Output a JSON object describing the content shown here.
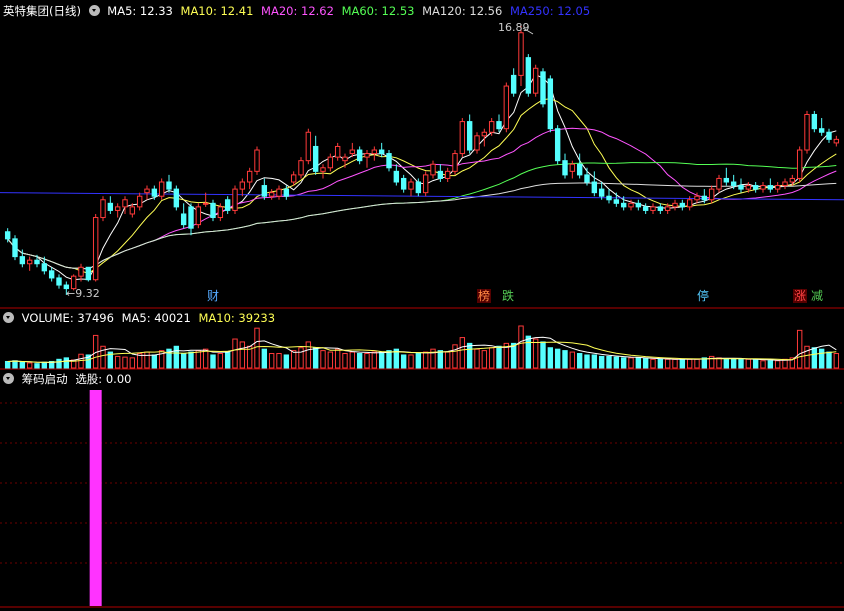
{
  "main_panel": {
    "stock_title": "英特集团(日线)",
    "ma_labels": [
      {
        "text": "MA5: 12.33",
        "color": "#ffffff"
      },
      {
        "text": "MA10: 12.41",
        "color": "#ffff55"
      },
      {
        "text": "MA20: 12.62",
        "color": "#ff55ff"
      },
      {
        "text": "MA60: 12.53",
        "color": "#55ff55"
      },
      {
        "text": "MA120: 12.56",
        "color": "#dddddd"
      },
      {
        "text": "MA250: 12.05",
        "color": "#3333ff"
      }
    ],
    "high_label": "16.89",
    "low_label": "←9.32",
    "event_markers": [
      {
        "text": "财",
        "color": "#55aaff"
      },
      {
        "text": "榜",
        "color": "#ff8844"
      },
      {
        "text": "跌",
        "color": "#55cc55"
      },
      {
        "text": "停",
        "color": "#55ccff"
      },
      {
        "text": "涨",
        "color": "#ff4444"
      },
      {
        "text": "减",
        "color": "#55cc55"
      }
    ]
  },
  "volume_panel": {
    "title": "VOLUME: 37496",
    "ma5": "MA5: 40021",
    "ma10": "MA10: 39233"
  },
  "indicator_panel": {
    "title": "筹码启动",
    "selection": "选股: 0.00"
  },
  "colors": {
    "up": "#ff3a3a",
    "down": "#55ffff",
    "grid": "#6b0000",
    "signal": "#ff33ff"
  },
  "chart_data": {
    "type": "candlestick",
    "y_range": [
      9.32,
      16.89
    ],
    "candles": [
      [
        11.1,
        11.2,
        10.8,
        10.9
      ],
      [
        10.9,
        11.0,
        10.3,
        10.4
      ],
      [
        10.4,
        10.6,
        10.1,
        10.2
      ],
      [
        10.2,
        10.4,
        10.0,
        10.3
      ],
      [
        10.3,
        10.45,
        10.1,
        10.2
      ],
      [
        10.2,
        10.4,
        9.9,
        10.0
      ],
      [
        10.0,
        10.1,
        9.7,
        9.8
      ],
      [
        9.8,
        9.9,
        9.5,
        9.6
      ],
      [
        9.6,
        9.7,
        9.32,
        9.5
      ],
      [
        9.5,
        9.9,
        9.45,
        9.85
      ],
      [
        9.85,
        10.2,
        9.7,
        10.1
      ],
      [
        10.1,
        10.0,
        9.7,
        9.75
      ],
      [
        9.75,
        11.6,
        9.7,
        11.5
      ],
      [
        11.5,
        12.1,
        11.4,
        12.0
      ],
      [
        11.9,
        12.1,
        11.6,
        11.7
      ],
      [
        11.7,
        11.9,
        11.5,
        11.8
      ],
      [
        11.8,
        12.1,
        11.6,
        12.0
      ],
      [
        11.6,
        11.9,
        11.5,
        11.8
      ],
      [
        11.8,
        12.2,
        11.7,
        12.1
      ],
      [
        12.2,
        12.4,
        12.0,
        12.3
      ],
      [
        12.3,
        12.4,
        12.0,
        12.1
      ],
      [
        12.1,
        12.6,
        12.0,
        12.5
      ],
      [
        12.5,
        12.7,
        12.2,
        12.3
      ],
      [
        12.3,
        12.4,
        11.7,
        11.8
      ],
      [
        11.6,
        11.9,
        11.2,
        11.3
      ],
      [
        11.8,
        11.9,
        11.0,
        11.2
      ],
      [
        11.3,
        11.9,
        11.2,
        11.8
      ],
      [
        11.9,
        12.2,
        11.8,
        11.9
      ],
      [
        11.9,
        12.0,
        11.4,
        11.5
      ],
      [
        11.5,
        11.9,
        11.4,
        11.8
      ],
      [
        12.0,
        12.1,
        11.6,
        11.7
      ],
      [
        11.7,
        12.4,
        11.6,
        12.3
      ],
      [
        12.3,
        12.6,
        12.1,
        12.5
      ],
      [
        12.5,
        12.9,
        12.3,
        12.8
      ],
      [
        12.8,
        13.5,
        12.7,
        13.4
      ],
      [
        12.4,
        12.6,
        12.0,
        12.1
      ],
      [
        12.1,
        12.3,
        12.0,
        12.2
      ],
      [
        12.1,
        12.4,
        12.0,
        12.3
      ],
      [
        12.3,
        12.4,
        12.0,
        12.1
      ],
      [
        12.5,
        12.8,
        12.4,
        12.7
      ],
      [
        12.7,
        13.2,
        12.6,
        13.1
      ],
      [
        13.1,
        14.0,
        13.0,
        13.9
      ],
      [
        13.5,
        13.8,
        12.7,
        12.8
      ],
      [
        12.8,
        13.0,
        12.6,
        12.9
      ],
      [
        12.9,
        13.3,
        12.8,
        13.2
      ],
      [
        13.2,
        13.6,
        13.1,
        13.5
      ],
      [
        13.1,
        13.3,
        12.9,
        13.2
      ],
      [
        13.3,
        13.6,
        13.2,
        13.4
      ],
      [
        13.4,
        13.5,
        13.0,
        13.1
      ],
      [
        13.2,
        13.4,
        12.9,
        13.3
      ],
      [
        13.3,
        13.5,
        13.1,
        13.4
      ],
      [
        13.4,
        13.6,
        13.2,
        13.3
      ],
      [
        13.3,
        13.4,
        12.8,
        12.9
      ],
      [
        12.8,
        13.0,
        12.4,
        12.5
      ],
      [
        12.6,
        12.7,
        12.2,
        12.3
      ],
      [
        12.3,
        12.6,
        12.1,
        12.5
      ],
      [
        12.5,
        12.6,
        12.1,
        12.2
      ],
      [
        12.2,
        12.8,
        12.1,
        12.7
      ],
      [
        12.7,
        13.1,
        12.6,
        13.0
      ],
      [
        12.8,
        13.0,
        12.5,
        12.6
      ],
      [
        12.6,
        12.9,
        12.5,
        12.8
      ],
      [
        12.8,
        13.4,
        12.7,
        13.3
      ],
      [
        13.3,
        14.3,
        13.2,
        14.2
      ],
      [
        14.2,
        14.4,
        13.3,
        13.4
      ],
      [
        13.4,
        13.9,
        13.3,
        13.8
      ],
      [
        13.8,
        14.0,
        13.5,
        13.9
      ],
      [
        13.9,
        14.3,
        13.8,
        14.2
      ],
      [
        14.2,
        14.4,
        13.9,
        14.0
      ],
      [
        14.0,
        15.3,
        13.9,
        15.2
      ],
      [
        15.5,
        15.7,
        14.9,
        15.0
      ],
      [
        15.5,
        16.89,
        15.2,
        16.7
      ],
      [
        16.0,
        16.1,
        14.9,
        15.0
      ],
      [
        15.0,
        15.8,
        14.9,
        15.7
      ],
      [
        15.6,
        15.7,
        14.6,
        14.7
      ],
      [
        15.4,
        15.5,
        13.9,
        14.0
      ],
      [
        14.0,
        14.1,
        13.0,
        13.1
      ],
      [
        13.1,
        13.3,
        12.6,
        12.7
      ],
      [
        12.8,
        13.1,
        12.6,
        13.0
      ],
      [
        13.0,
        13.3,
        12.6,
        12.7
      ],
      [
        12.7,
        12.9,
        12.4,
        12.5
      ],
      [
        12.5,
        12.8,
        12.1,
        12.2
      ],
      [
        12.3,
        12.5,
        12.0,
        12.1
      ],
      [
        12.1,
        12.3,
        11.9,
        12.0
      ],
      [
        12.0,
        12.2,
        11.8,
        11.9
      ],
      [
        11.9,
        12.1,
        11.7,
        11.8
      ],
      [
        11.8,
        12.0,
        11.7,
        11.9
      ],
      [
        11.9,
        12.0,
        11.7,
        11.8
      ],
      [
        11.8,
        11.9,
        11.6,
        11.7
      ],
      [
        11.7,
        11.9,
        11.6,
        11.8
      ],
      [
        11.8,
        11.9,
        11.6,
        11.7
      ],
      [
        11.7,
        11.9,
        11.6,
        11.8
      ],
      [
        11.8,
        12.0,
        11.7,
        11.9
      ],
      [
        11.9,
        12.0,
        11.7,
        11.8
      ],
      [
        11.8,
        12.1,
        11.7,
        12.0
      ],
      [
        12.0,
        12.2,
        11.9,
        12.1
      ],
      [
        12.1,
        12.3,
        11.9,
        12.0
      ],
      [
        12.0,
        12.4,
        11.9,
        12.3
      ],
      [
        12.3,
        12.7,
        12.2,
        12.6
      ],
      [
        12.6,
        12.9,
        12.4,
        12.5
      ],
      [
        12.5,
        12.7,
        12.3,
        12.4
      ],
      [
        12.4,
        12.6,
        12.2,
        12.3
      ],
      [
        12.3,
        12.5,
        12.2,
        12.4
      ],
      [
        12.4,
        12.5,
        12.2,
        12.3
      ],
      [
        12.3,
        12.5,
        12.2,
        12.4
      ],
      [
        12.4,
        12.6,
        12.2,
        12.3
      ],
      [
        12.3,
        12.5,
        12.2,
        12.4
      ],
      [
        12.4,
        12.6,
        12.3,
        12.5
      ],
      [
        12.5,
        12.7,
        12.4,
        12.6
      ],
      [
        12.6,
        13.5,
        12.5,
        13.4
      ],
      [
        13.4,
        14.5,
        13.3,
        14.4
      ],
      [
        14.4,
        14.5,
        13.9,
        14.0
      ],
      [
        14.0,
        14.3,
        13.8,
        13.9
      ],
      [
        13.9,
        14.0,
        13.6,
        13.7
      ],
      [
        13.6,
        13.8,
        13.5,
        13.7
      ]
    ],
    "volume": [
      9,
      10,
      8,
      7,
      6,
      8,
      9,
      12,
      14,
      11,
      19,
      18,
      45,
      30,
      22,
      16,
      15,
      14,
      20,
      22,
      18,
      24,
      26,
      30,
      20,
      22,
      24,
      26,
      18,
      20,
      22,
      40,
      36,
      30,
      55,
      26,
      20,
      20,
      18,
      24,
      28,
      36,
      28,
      24,
      22,
      26,
      20,
      22,
      20,
      20,
      22,
      22,
      24,
      26,
      18,
      18,
      20,
      22,
      26,
      24,
      22,
      32,
      42,
      34,
      26,
      24,
      28,
      30,
      34,
      34,
      58,
      44,
      40,
      36,
      28,
      26,
      24,
      22,
      20,
      18,
      18,
      16,
      16,
      15,
      14,
      14,
      14,
      13,
      12,
      12,
      12,
      12,
      12,
      12,
      12,
      14,
      16,
      14,
      12,
      12,
      12,
      12,
      12,
      10,
      10,
      10,
      12,
      14,
      52,
      30,
      28,
      26,
      22,
      20
    ],
    "signal_bar": {
      "index": 12,
      "value": 1
    }
  }
}
